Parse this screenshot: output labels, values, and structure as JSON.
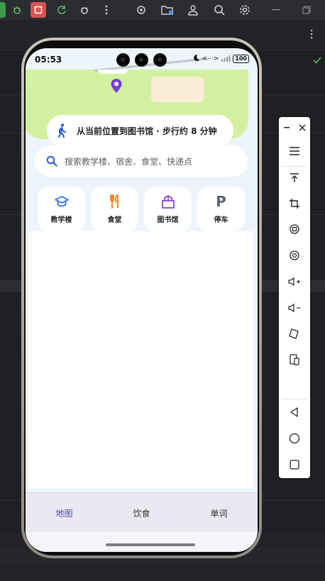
{
  "ide": {
    "toolbar_icons": [
      "debug-bug-icon",
      "stop-icon",
      "apply-changes-icon",
      "attach-debugger-icon",
      "more-vert-icon",
      "target-icon",
      "device-explorer-icon",
      "account-icon",
      "search-icon",
      "settings-icon",
      "minimize-icon",
      "restore-icon"
    ],
    "colors": {
      "run_green": "#3e9a4c",
      "stop_red": "#d9534f",
      "check_green": "#4caf50"
    }
  },
  "phone": {
    "status_bar": {
      "time": "05:53",
      "icons": [
        "moon-icon",
        "data-transfer-icon",
        "signal-icon",
        "battery-icon"
      ],
      "data_label": "<···>",
      "battery": "100"
    },
    "map": {
      "colors": {
        "park": "#d2f1a0",
        "pin": "#7a3cd6",
        "road": "#c0c5cc",
        "building": "#fbecd8"
      }
    },
    "route": {
      "text": "从当前位置到图书馆 · 步行约 8 分钟",
      "icon": "walking-icon"
    },
    "search": {
      "placeholder": "搜索教学楼、宿舍、食堂、快递点",
      "icon": "search-icon"
    },
    "quick_links": [
      {
        "label": "教学楼",
        "icon": "graduation-cap-icon",
        "color": "#2f6fe0"
      },
      {
        "label": "食堂",
        "icon": "fork-knife-icon",
        "color": "#f07a1a"
      },
      {
        "label": "图书馆",
        "icon": "book-box-icon",
        "color": "#8a3fd1"
      },
      {
        "label": "停车",
        "icon": "parking-icon",
        "color": "#5a6470",
        "glyph": "P"
      }
    ],
    "bottom_nav": [
      {
        "label": "地图",
        "active": true
      },
      {
        "label": "饮食",
        "active": false
      },
      {
        "label": "单词",
        "active": false
      }
    ],
    "colors": {
      "active_tab": "#3f51a8",
      "inactive_tab": "#333333"
    }
  },
  "emulator_panel": {
    "buttons": [
      "minimize-icon",
      "close-icon",
      "menu-icon",
      "upload-icon",
      "crop-icon",
      "rotate-left-icon",
      "rotate-right-icon",
      "volume-up-icon",
      "volume-down-icon",
      "fold-icon",
      "device-mirror-icon",
      "back-icon",
      "home-icon",
      "overview-icon"
    ]
  }
}
